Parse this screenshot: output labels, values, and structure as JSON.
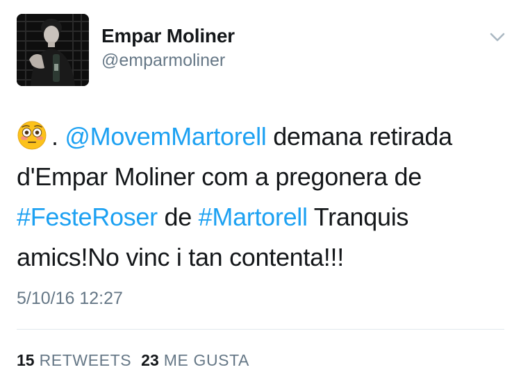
{
  "user": {
    "display_name": "Empar Moliner",
    "handle": "@emparmoliner"
  },
  "tweet": {
    "emoji": "flushed-face",
    "text_parts": [
      ". ",
      "@MovemMartorell",
      " demana retirada d'Empar Moliner com a pregonera de ",
      "#FesteRoser",
      " de ",
      "#Martorell",
      " Tranquis amics!No vinc i tan contenta!!!"
    ],
    "timestamp": "5/10/16 12:27"
  },
  "stats": {
    "retweets_count": "15",
    "retweets_label": "RETWEETS",
    "likes_count": "23",
    "likes_label": "ME GUSTA"
  },
  "icons": {
    "menu": "chevron-down-icon",
    "avatar": "profile-photo"
  },
  "colors": {
    "link": "#1da1f2",
    "text": "#14171a",
    "secondary": "#657786",
    "divider": "#e1e8ed"
  }
}
